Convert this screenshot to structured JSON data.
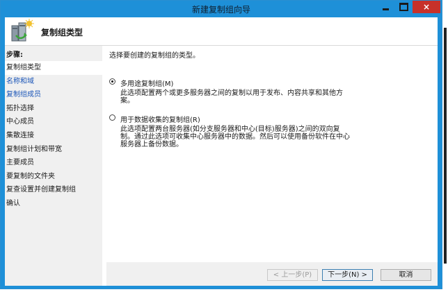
{
  "window": {
    "title": "新建复制组向导",
    "controls": {
      "minimize": "minimize",
      "maximize": "maximize",
      "close": "×"
    }
  },
  "header": {
    "title": "复制组类型",
    "icon": "replication-wizard-icon"
  },
  "sidebar": {
    "steps_label": "步骤:",
    "steps": [
      {
        "label": "复制组类型",
        "state": "current"
      },
      {
        "label": "名称和域",
        "state": "link"
      },
      {
        "label": "复制组成员",
        "state": "link"
      },
      {
        "label": "拓扑选择",
        "state": "normal"
      },
      {
        "label": "中心成员",
        "state": "normal"
      },
      {
        "label": "集散连接",
        "state": "normal"
      },
      {
        "label": "复制组计划和带宽",
        "state": "normal"
      },
      {
        "label": "主要成员",
        "state": "normal"
      },
      {
        "label": "要复制的文件夹",
        "state": "normal"
      },
      {
        "label": "复查设置并创建复制组",
        "state": "normal"
      },
      {
        "label": "确认",
        "state": "normal"
      }
    ]
  },
  "main": {
    "prompt": "选择要创建的复制组的类型。",
    "options": [
      {
        "label": "多用途复制组(M)",
        "description": "此选项配置两个或更多服务器之间的复制以用于发布、内容共享和其他方案。",
        "selected": true
      },
      {
        "label": "用于数据收集的复制组(R)",
        "description": "此选项配置两台服务器(如分支服务器和中心(目标)服务器)之间的双向复制。通过此选项可收集中心服务器中的数据。然后可以使用备份软件在中心服务器上备份数据。",
        "selected": false
      }
    ]
  },
  "footer": {
    "back": "< 上一步(P)",
    "next": "下一步(N) >",
    "cancel": "取消"
  },
  "colors": {
    "titlebar": "#1e90d8",
    "close_button": "#c7312a",
    "link_text": "#1a55b8",
    "sidebar_bg": "#f0f0f0"
  }
}
